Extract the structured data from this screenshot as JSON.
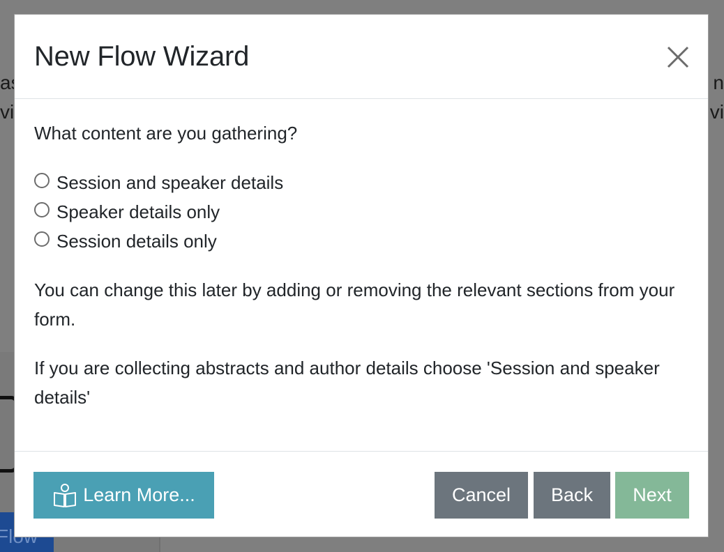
{
  "background": {
    "left_text": "as vi",
    "right_text": "n vi",
    "flow_button_label": "Flow"
  },
  "modal": {
    "title": "New Flow Wizard",
    "close_icon": "close-icon",
    "question": "What content are you gathering?",
    "options": [
      {
        "label": "Session and speaker details",
        "selected": false
      },
      {
        "label": "Speaker details only",
        "selected": false
      },
      {
        "label": "Session details only",
        "selected": false
      }
    ],
    "paragraph1": "You can change this later by adding or removing the relevant sections from your form.",
    "paragraph2": "If you are collecting abstracts and author details choose 'Session and speaker details'"
  },
  "footer": {
    "learn_more_label": "Learn More...",
    "learn_more_icon": "book-reader-icon",
    "cancel_label": "Cancel",
    "back_label": "Back",
    "next_label": "Next"
  },
  "colors": {
    "overlay": "#808080",
    "learn_more": "#4aa0b4",
    "secondary": "#6c757d",
    "next_disabled": "#84b898"
  }
}
